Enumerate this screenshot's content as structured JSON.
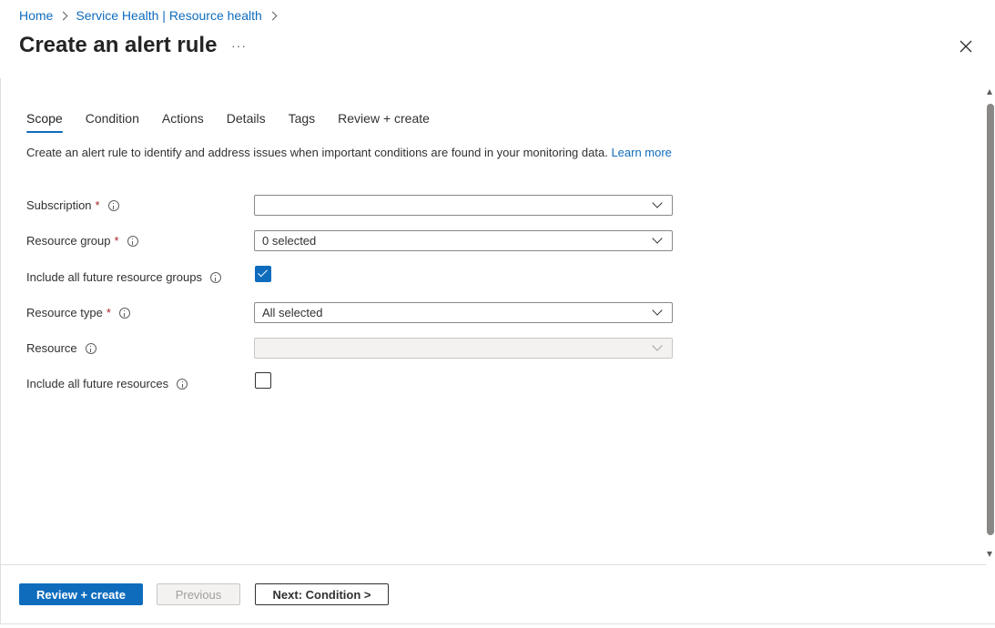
{
  "breadcrumb": {
    "items": [
      "Home",
      "Service Health | Resource health"
    ]
  },
  "header": {
    "title": "Create an alert rule",
    "more": "···"
  },
  "tabs": [
    {
      "label": "Scope",
      "active": true
    },
    {
      "label": "Condition",
      "active": false
    },
    {
      "label": "Actions",
      "active": false
    },
    {
      "label": "Details",
      "active": false
    },
    {
      "label": "Tags",
      "active": false
    },
    {
      "label": "Review + create",
      "active": false
    }
  ],
  "description": {
    "text": "Create an alert rule to identify and address issues when important conditions are found in your monitoring data.",
    "link": "Learn more"
  },
  "form": {
    "subscription": {
      "label": "Subscription",
      "required": "*",
      "value": ""
    },
    "resource_group": {
      "label": "Resource group",
      "required": "*",
      "value": "0 selected"
    },
    "include_future_rg": {
      "label": "Include all future resource groups",
      "checked": true
    },
    "resource_type": {
      "label": "Resource type",
      "required": "*",
      "value": "All selected"
    },
    "resource": {
      "label": "Resource",
      "value": "",
      "disabled": true
    },
    "include_future_resources": {
      "label": "Include all future resources",
      "checked": false
    }
  },
  "footer": {
    "review_create": "Review + create",
    "previous": "Previous",
    "next": "Next: Condition >"
  },
  "colors": {
    "accent": "#0f6cbd",
    "required": "#a4262c"
  }
}
